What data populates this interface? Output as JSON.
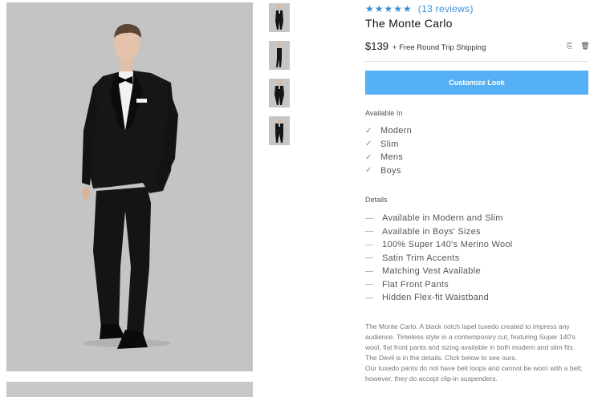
{
  "gallery": {
    "main_image": "black tuxedo model full length",
    "thumbnails": [
      "front view",
      "side view",
      "standing pose",
      "walking pose"
    ]
  },
  "product": {
    "stars": "★★★★★",
    "reviews": "(13 reviews)",
    "title": "The Monte Carlo",
    "price": "$139",
    "shipping": "+ Free Round Trip Shipping",
    "share_icons": [
      "save-icon",
      "delete-icon"
    ],
    "cta_label": "Customize Look"
  },
  "available": {
    "heading": "Available In",
    "items": [
      "Modern",
      "Slim",
      "Mens",
      "Boys"
    ]
  },
  "details": {
    "heading": "Details",
    "items": [
      "Available in Modern and Slim",
      "Available in Boys' Sizes",
      "100% Super 140's Merino Wool",
      "Satin Trim Accents",
      "Matching Vest Available",
      "Flat Front Pants",
      "Hidden Flex-fit Waistband"
    ]
  },
  "description": {
    "p1": "The Monte Carlo. A black notch lapel tuxedo created to impress any audience. Timeless style in a contemporary cut, featuring Super 140's wool, flat front pants and sizing available in both modern and slim fits.",
    "p2": "The Devil is in the details. Click below to see ours.",
    "p3": "Our tuxedo pants do not have belt loops and cannot be worn with a belt; however, they do accept clip-in suspenders."
  },
  "colors": {
    "accent": "#3b8fd9",
    "button": "#56b0f5",
    "photo_bg": "#c4c4c4"
  }
}
